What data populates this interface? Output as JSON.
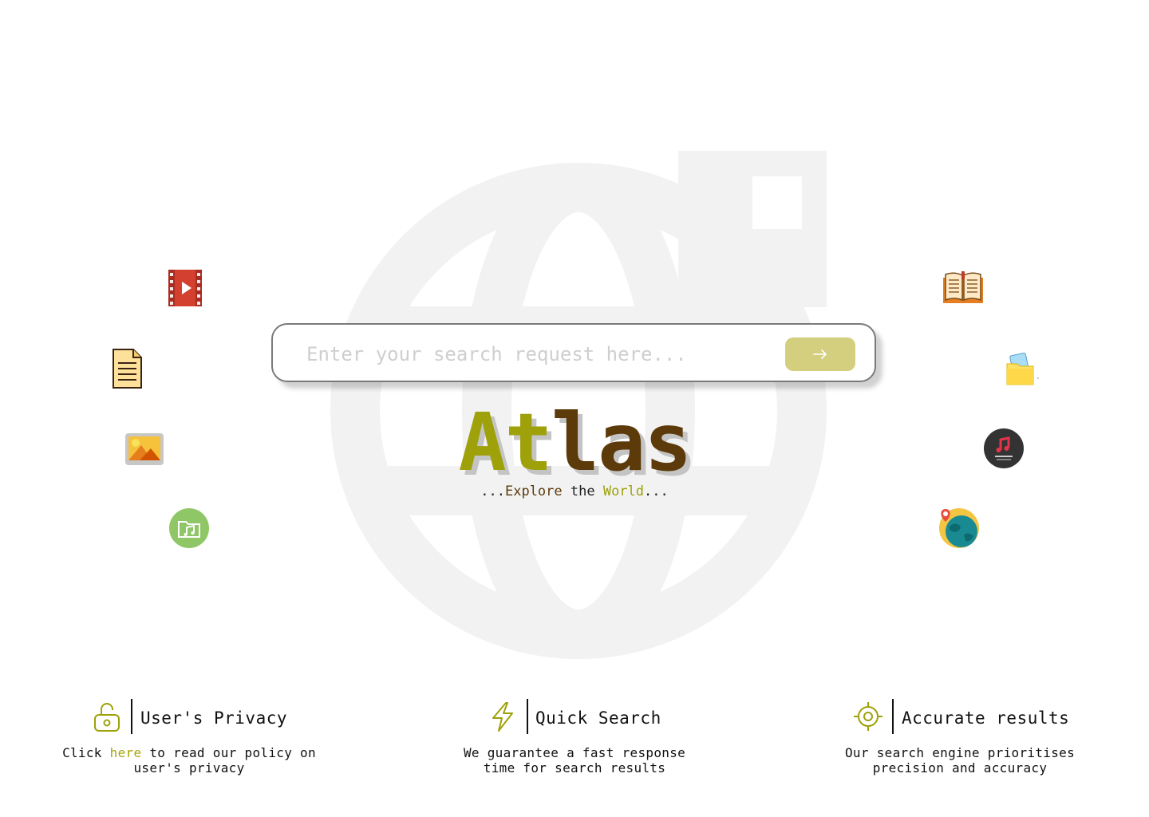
{
  "search": {
    "placeholder": "Enter your search request here...",
    "value": "",
    "button_icon": "arrow-right-icon"
  },
  "logo": {
    "part1": "At",
    "part2": "las",
    "colors": {
      "part1": "#9ea10a",
      "part2": "#5c3a0a"
    }
  },
  "tagline": {
    "lead": "...",
    "word1": "Explore",
    "middle": " the ",
    "word2": "World",
    "trail": "..."
  },
  "category_icons": {
    "left": [
      "video-icon",
      "document-icon",
      "image-icon",
      "music-folder-icon"
    ],
    "right": [
      "book-icon",
      "folder-icon",
      "music-icon",
      "map-globe-icon"
    ]
  },
  "background_icon": "globe-icon",
  "features": [
    {
      "icon": "unlock-icon",
      "title": "User's Privacy",
      "desc_before": "Click ",
      "link_text": "here",
      "desc_after": " to read our policy on user's privacy"
    },
    {
      "icon": "lightning-icon",
      "title": "Quick Search",
      "desc": "We guarantee a fast response time for search results"
    },
    {
      "icon": "target-icon",
      "title": "Accurate results",
      "desc": "Our search engine prioritises precision and accuracy"
    }
  ],
  "colors": {
    "accent": "#9ea10a",
    "brown": "#5c3a0a",
    "button": "#d4cf7f",
    "link": "#a6a40b"
  }
}
